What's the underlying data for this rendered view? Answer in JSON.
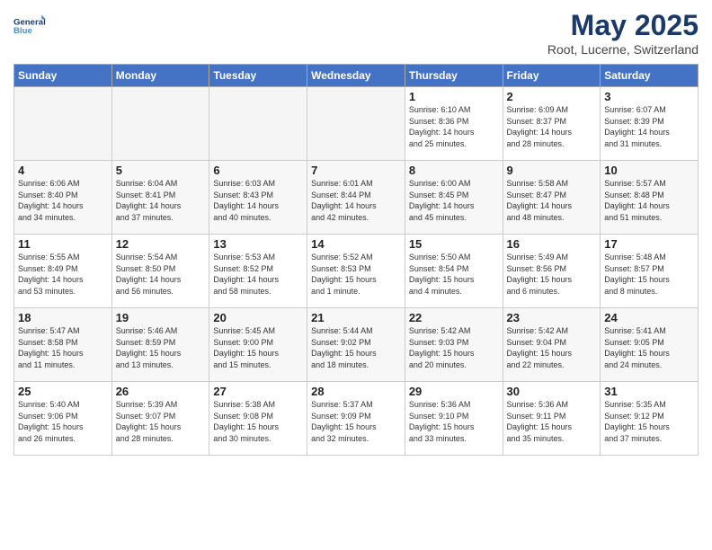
{
  "header": {
    "logo_line1": "General",
    "logo_line2": "Blue",
    "title": "May 2025",
    "location": "Root, Lucerne, Switzerland"
  },
  "days_of_week": [
    "Sunday",
    "Monday",
    "Tuesday",
    "Wednesday",
    "Thursday",
    "Friday",
    "Saturday"
  ],
  "weeks": [
    [
      {
        "num": "",
        "info": "",
        "empty": true
      },
      {
        "num": "",
        "info": "",
        "empty": true
      },
      {
        "num": "",
        "info": "",
        "empty": true
      },
      {
        "num": "",
        "info": "",
        "empty": true
      },
      {
        "num": "1",
        "info": "Sunrise: 6:10 AM\nSunset: 8:36 PM\nDaylight: 14 hours\nand 25 minutes.",
        "empty": false
      },
      {
        "num": "2",
        "info": "Sunrise: 6:09 AM\nSunset: 8:37 PM\nDaylight: 14 hours\nand 28 minutes.",
        "empty": false
      },
      {
        "num": "3",
        "info": "Sunrise: 6:07 AM\nSunset: 8:39 PM\nDaylight: 14 hours\nand 31 minutes.",
        "empty": false
      }
    ],
    [
      {
        "num": "4",
        "info": "Sunrise: 6:06 AM\nSunset: 8:40 PM\nDaylight: 14 hours\nand 34 minutes.",
        "empty": false
      },
      {
        "num": "5",
        "info": "Sunrise: 6:04 AM\nSunset: 8:41 PM\nDaylight: 14 hours\nand 37 minutes.",
        "empty": false
      },
      {
        "num": "6",
        "info": "Sunrise: 6:03 AM\nSunset: 8:43 PM\nDaylight: 14 hours\nand 40 minutes.",
        "empty": false
      },
      {
        "num": "7",
        "info": "Sunrise: 6:01 AM\nSunset: 8:44 PM\nDaylight: 14 hours\nand 42 minutes.",
        "empty": false
      },
      {
        "num": "8",
        "info": "Sunrise: 6:00 AM\nSunset: 8:45 PM\nDaylight: 14 hours\nand 45 minutes.",
        "empty": false
      },
      {
        "num": "9",
        "info": "Sunrise: 5:58 AM\nSunset: 8:47 PM\nDaylight: 14 hours\nand 48 minutes.",
        "empty": false
      },
      {
        "num": "10",
        "info": "Sunrise: 5:57 AM\nSunset: 8:48 PM\nDaylight: 14 hours\nand 51 minutes.",
        "empty": false
      }
    ],
    [
      {
        "num": "11",
        "info": "Sunrise: 5:55 AM\nSunset: 8:49 PM\nDaylight: 14 hours\nand 53 minutes.",
        "empty": false
      },
      {
        "num": "12",
        "info": "Sunrise: 5:54 AM\nSunset: 8:50 PM\nDaylight: 14 hours\nand 56 minutes.",
        "empty": false
      },
      {
        "num": "13",
        "info": "Sunrise: 5:53 AM\nSunset: 8:52 PM\nDaylight: 14 hours\nand 58 minutes.",
        "empty": false
      },
      {
        "num": "14",
        "info": "Sunrise: 5:52 AM\nSunset: 8:53 PM\nDaylight: 15 hours\nand 1 minute.",
        "empty": false
      },
      {
        "num": "15",
        "info": "Sunrise: 5:50 AM\nSunset: 8:54 PM\nDaylight: 15 hours\nand 4 minutes.",
        "empty": false
      },
      {
        "num": "16",
        "info": "Sunrise: 5:49 AM\nSunset: 8:56 PM\nDaylight: 15 hours\nand 6 minutes.",
        "empty": false
      },
      {
        "num": "17",
        "info": "Sunrise: 5:48 AM\nSunset: 8:57 PM\nDaylight: 15 hours\nand 8 minutes.",
        "empty": false
      }
    ],
    [
      {
        "num": "18",
        "info": "Sunrise: 5:47 AM\nSunset: 8:58 PM\nDaylight: 15 hours\nand 11 minutes.",
        "empty": false
      },
      {
        "num": "19",
        "info": "Sunrise: 5:46 AM\nSunset: 8:59 PM\nDaylight: 15 hours\nand 13 minutes.",
        "empty": false
      },
      {
        "num": "20",
        "info": "Sunrise: 5:45 AM\nSunset: 9:00 PM\nDaylight: 15 hours\nand 15 minutes.",
        "empty": false
      },
      {
        "num": "21",
        "info": "Sunrise: 5:44 AM\nSunset: 9:02 PM\nDaylight: 15 hours\nand 18 minutes.",
        "empty": false
      },
      {
        "num": "22",
        "info": "Sunrise: 5:42 AM\nSunset: 9:03 PM\nDaylight: 15 hours\nand 20 minutes.",
        "empty": false
      },
      {
        "num": "23",
        "info": "Sunrise: 5:42 AM\nSunset: 9:04 PM\nDaylight: 15 hours\nand 22 minutes.",
        "empty": false
      },
      {
        "num": "24",
        "info": "Sunrise: 5:41 AM\nSunset: 9:05 PM\nDaylight: 15 hours\nand 24 minutes.",
        "empty": false
      }
    ],
    [
      {
        "num": "25",
        "info": "Sunrise: 5:40 AM\nSunset: 9:06 PM\nDaylight: 15 hours\nand 26 minutes.",
        "empty": false
      },
      {
        "num": "26",
        "info": "Sunrise: 5:39 AM\nSunset: 9:07 PM\nDaylight: 15 hours\nand 28 minutes.",
        "empty": false
      },
      {
        "num": "27",
        "info": "Sunrise: 5:38 AM\nSunset: 9:08 PM\nDaylight: 15 hours\nand 30 minutes.",
        "empty": false
      },
      {
        "num": "28",
        "info": "Sunrise: 5:37 AM\nSunset: 9:09 PM\nDaylight: 15 hours\nand 32 minutes.",
        "empty": false
      },
      {
        "num": "29",
        "info": "Sunrise: 5:36 AM\nSunset: 9:10 PM\nDaylight: 15 hours\nand 33 minutes.",
        "empty": false
      },
      {
        "num": "30",
        "info": "Sunrise: 5:36 AM\nSunset: 9:11 PM\nDaylight: 15 hours\nand 35 minutes.",
        "empty": false
      },
      {
        "num": "31",
        "info": "Sunrise: 5:35 AM\nSunset: 9:12 PM\nDaylight: 15 hours\nand 37 minutes.",
        "empty": false
      }
    ]
  ]
}
